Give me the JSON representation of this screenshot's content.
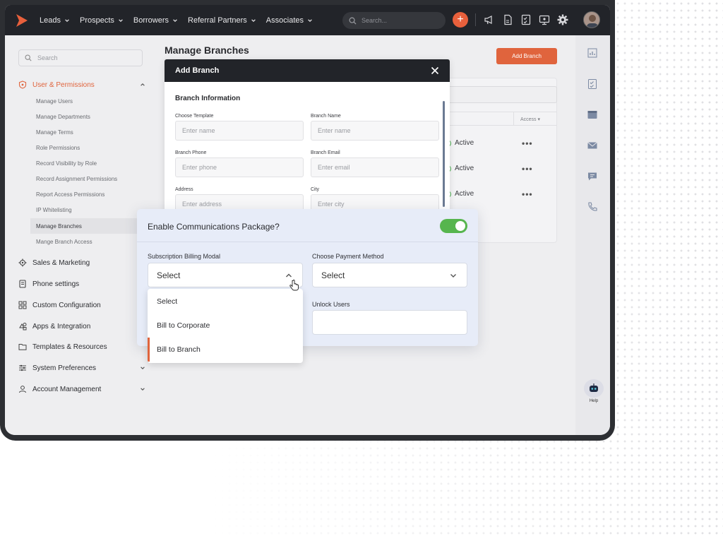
{
  "topnav": {
    "items": [
      "Leads",
      "Prospects",
      "Borrowers",
      "Referral Partners",
      "Associates"
    ],
    "search_placeholder": "Search...",
    "plus_label": "+"
  },
  "sidebar": {
    "search_placeholder": "Search",
    "sections": [
      {
        "label": "User & Permissions",
        "icon": "shield-icon",
        "expanded": true
      },
      {
        "label": "Sales & Marketing",
        "icon": "gear-icon"
      },
      {
        "label": "Phone settings",
        "icon": "phone-document-icon"
      },
      {
        "label": "Custom Configuration",
        "icon": "grid-icon"
      },
      {
        "label": "Apps & Integration",
        "icon": "apps-icon"
      },
      {
        "label": "Templates & Resources",
        "icon": "folder-icon"
      },
      {
        "label": "System Preferences",
        "icon": "sliders-icon"
      },
      {
        "label": "Account Management",
        "icon": "user-icon"
      }
    ],
    "user_permissions_items": [
      "Manage Users",
      "Manage Departments",
      "Manage Terms",
      "Role Permissions",
      "Record Visibility by Role",
      "Record Assignment Permissions",
      "Report Access Permissions",
      "IP Whitelisting",
      "Manage Branches",
      "Mange Branch Access"
    ],
    "selected_item": "Manage Branches"
  },
  "main": {
    "title": "Manage Branches",
    "add_button": "Add Branch",
    "table": {
      "access_header": "Access",
      "rows": [
        {
          "status": "Active",
          "actions": "•••"
        },
        {
          "status": "Active",
          "actions": "•••"
        },
        {
          "status": "Active",
          "actions": "•••"
        }
      ]
    }
  },
  "modal": {
    "title": "Add Branch",
    "section_title": "Branch Information",
    "fields": [
      {
        "label": "Choose Template",
        "placeholder": "Enter name"
      },
      {
        "label": "Branch Name",
        "placeholder": "Enter name"
      },
      {
        "label": "Branch Phone",
        "placeholder": "Enter phone"
      },
      {
        "label": "Branch Email",
        "placeholder": "Enter email"
      },
      {
        "label": "Address",
        "placeholder": "Enter address"
      },
      {
        "label": "City",
        "placeholder": "Enter city"
      }
    ]
  },
  "communications": {
    "title": "Enable Communications Package?",
    "toggle_on": true,
    "billing_label": "Subscription Billing Modal",
    "billing_value": "Select",
    "payment_label": "Choose Payment Method",
    "payment_value": "Select",
    "unlock_label": "Unlock Users",
    "billing_options": [
      "Select",
      "Bill to Corporate",
      "Bill to Branch"
    ],
    "highlighted_option": "Bill to Branch"
  },
  "help": {
    "label": "Help"
  },
  "colors": {
    "accent": "#e0643d",
    "topbar": "#222429",
    "toggle_on": "#56b54e",
    "panel_bg": "#e7ecf8"
  }
}
